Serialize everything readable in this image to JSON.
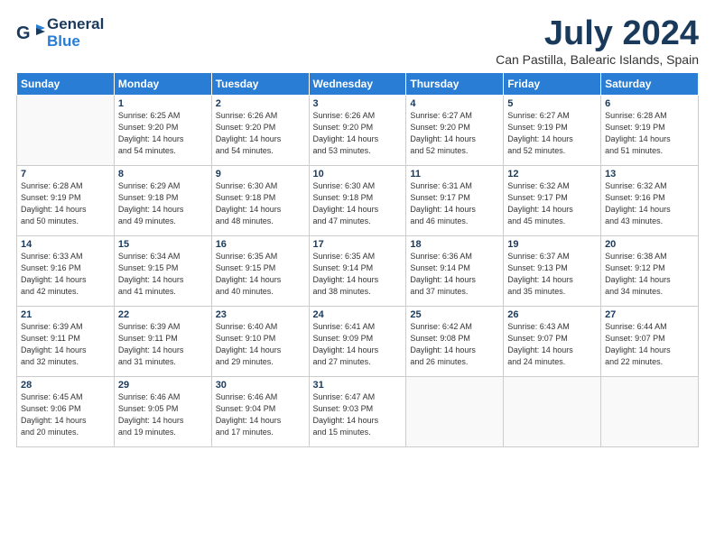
{
  "header": {
    "logo_line1": "General",
    "logo_line2": "Blue",
    "month": "July 2024",
    "location": "Can Pastilla, Balearic Islands, Spain"
  },
  "weekdays": [
    "Sunday",
    "Monday",
    "Tuesday",
    "Wednesday",
    "Thursday",
    "Friday",
    "Saturday"
  ],
  "weeks": [
    [
      {
        "num": "",
        "info": ""
      },
      {
        "num": "1",
        "info": "Sunrise: 6:25 AM\nSunset: 9:20 PM\nDaylight: 14 hours\nand 54 minutes."
      },
      {
        "num": "2",
        "info": "Sunrise: 6:26 AM\nSunset: 9:20 PM\nDaylight: 14 hours\nand 54 minutes."
      },
      {
        "num": "3",
        "info": "Sunrise: 6:26 AM\nSunset: 9:20 PM\nDaylight: 14 hours\nand 53 minutes."
      },
      {
        "num": "4",
        "info": "Sunrise: 6:27 AM\nSunset: 9:20 PM\nDaylight: 14 hours\nand 52 minutes."
      },
      {
        "num": "5",
        "info": "Sunrise: 6:27 AM\nSunset: 9:19 PM\nDaylight: 14 hours\nand 52 minutes."
      },
      {
        "num": "6",
        "info": "Sunrise: 6:28 AM\nSunset: 9:19 PM\nDaylight: 14 hours\nand 51 minutes."
      }
    ],
    [
      {
        "num": "7",
        "info": "Sunrise: 6:28 AM\nSunset: 9:19 PM\nDaylight: 14 hours\nand 50 minutes."
      },
      {
        "num": "8",
        "info": "Sunrise: 6:29 AM\nSunset: 9:18 PM\nDaylight: 14 hours\nand 49 minutes."
      },
      {
        "num": "9",
        "info": "Sunrise: 6:30 AM\nSunset: 9:18 PM\nDaylight: 14 hours\nand 48 minutes."
      },
      {
        "num": "10",
        "info": "Sunrise: 6:30 AM\nSunset: 9:18 PM\nDaylight: 14 hours\nand 47 minutes."
      },
      {
        "num": "11",
        "info": "Sunrise: 6:31 AM\nSunset: 9:17 PM\nDaylight: 14 hours\nand 46 minutes."
      },
      {
        "num": "12",
        "info": "Sunrise: 6:32 AM\nSunset: 9:17 PM\nDaylight: 14 hours\nand 45 minutes."
      },
      {
        "num": "13",
        "info": "Sunrise: 6:32 AM\nSunset: 9:16 PM\nDaylight: 14 hours\nand 43 minutes."
      }
    ],
    [
      {
        "num": "14",
        "info": "Sunrise: 6:33 AM\nSunset: 9:16 PM\nDaylight: 14 hours\nand 42 minutes."
      },
      {
        "num": "15",
        "info": "Sunrise: 6:34 AM\nSunset: 9:15 PM\nDaylight: 14 hours\nand 41 minutes."
      },
      {
        "num": "16",
        "info": "Sunrise: 6:35 AM\nSunset: 9:15 PM\nDaylight: 14 hours\nand 40 minutes."
      },
      {
        "num": "17",
        "info": "Sunrise: 6:35 AM\nSunset: 9:14 PM\nDaylight: 14 hours\nand 38 minutes."
      },
      {
        "num": "18",
        "info": "Sunrise: 6:36 AM\nSunset: 9:14 PM\nDaylight: 14 hours\nand 37 minutes."
      },
      {
        "num": "19",
        "info": "Sunrise: 6:37 AM\nSunset: 9:13 PM\nDaylight: 14 hours\nand 35 minutes."
      },
      {
        "num": "20",
        "info": "Sunrise: 6:38 AM\nSunset: 9:12 PM\nDaylight: 14 hours\nand 34 minutes."
      }
    ],
    [
      {
        "num": "21",
        "info": "Sunrise: 6:39 AM\nSunset: 9:11 PM\nDaylight: 14 hours\nand 32 minutes."
      },
      {
        "num": "22",
        "info": "Sunrise: 6:39 AM\nSunset: 9:11 PM\nDaylight: 14 hours\nand 31 minutes."
      },
      {
        "num": "23",
        "info": "Sunrise: 6:40 AM\nSunset: 9:10 PM\nDaylight: 14 hours\nand 29 minutes."
      },
      {
        "num": "24",
        "info": "Sunrise: 6:41 AM\nSunset: 9:09 PM\nDaylight: 14 hours\nand 27 minutes."
      },
      {
        "num": "25",
        "info": "Sunrise: 6:42 AM\nSunset: 9:08 PM\nDaylight: 14 hours\nand 26 minutes."
      },
      {
        "num": "26",
        "info": "Sunrise: 6:43 AM\nSunset: 9:07 PM\nDaylight: 14 hours\nand 24 minutes."
      },
      {
        "num": "27",
        "info": "Sunrise: 6:44 AM\nSunset: 9:07 PM\nDaylight: 14 hours\nand 22 minutes."
      }
    ],
    [
      {
        "num": "28",
        "info": "Sunrise: 6:45 AM\nSunset: 9:06 PM\nDaylight: 14 hours\nand 20 minutes."
      },
      {
        "num": "29",
        "info": "Sunrise: 6:46 AM\nSunset: 9:05 PM\nDaylight: 14 hours\nand 19 minutes."
      },
      {
        "num": "30",
        "info": "Sunrise: 6:46 AM\nSunset: 9:04 PM\nDaylight: 14 hours\nand 17 minutes."
      },
      {
        "num": "31",
        "info": "Sunrise: 6:47 AM\nSunset: 9:03 PM\nDaylight: 14 hours\nand 15 minutes."
      },
      {
        "num": "",
        "info": ""
      },
      {
        "num": "",
        "info": ""
      },
      {
        "num": "",
        "info": ""
      }
    ]
  ]
}
